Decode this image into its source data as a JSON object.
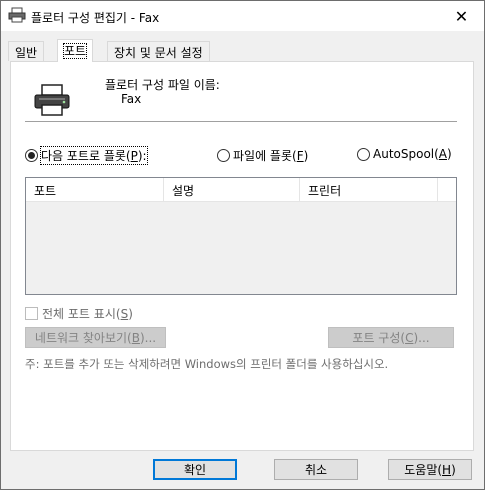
{
  "window": {
    "title": "플로터 구성 편집기 - Fax",
    "close_glyph": "✕"
  },
  "tabs": [
    {
      "label": "일반"
    },
    {
      "label": "포트"
    },
    {
      "label": "장치 및 문서 설정"
    }
  ],
  "active_tab": "포트",
  "config": {
    "label": "플로터 구성 파일 이름:",
    "value": "Fax"
  },
  "radios": [
    {
      "label_pre": "다음 포트로 플롯(",
      "key": "P",
      "label_post": "):",
      "selected": true
    },
    {
      "label_pre": "파일에 플롯(",
      "key": "F",
      "label_post": ")",
      "selected": false
    },
    {
      "label_pre": "AutoSpool(",
      "key": "A",
      "label_post": ")",
      "selected": false
    }
  ],
  "port_list": {
    "columns": [
      "포트",
      "설명",
      "프린터"
    ],
    "rows": []
  },
  "show_all_ports": {
    "label_pre": "전체 포트 표시(",
    "key": "S",
    "label_post": ")",
    "checked": false
  },
  "buttons": {
    "browse_network": {
      "label_pre": "네트워크 찾아보기(",
      "key": "B",
      "label_post": ")..."
    },
    "configure_port": {
      "label_pre": "포트 구성(",
      "key": "C",
      "label_post": ")..."
    },
    "ok": {
      "label": "확인"
    },
    "cancel": {
      "label": "취소"
    },
    "help": {
      "label_pre": "도움말(",
      "key": "H",
      "label_post": ")"
    }
  },
  "note": "주: 포트를 추가 또는 삭제하려면 Windows의 프린터 폴더를 사용하십시오.",
  "colors": {
    "panel": "#ffffff",
    "dialog": "#f0f0f0",
    "default_button_border": "#0078d7",
    "disabled_text": "#838383"
  }
}
